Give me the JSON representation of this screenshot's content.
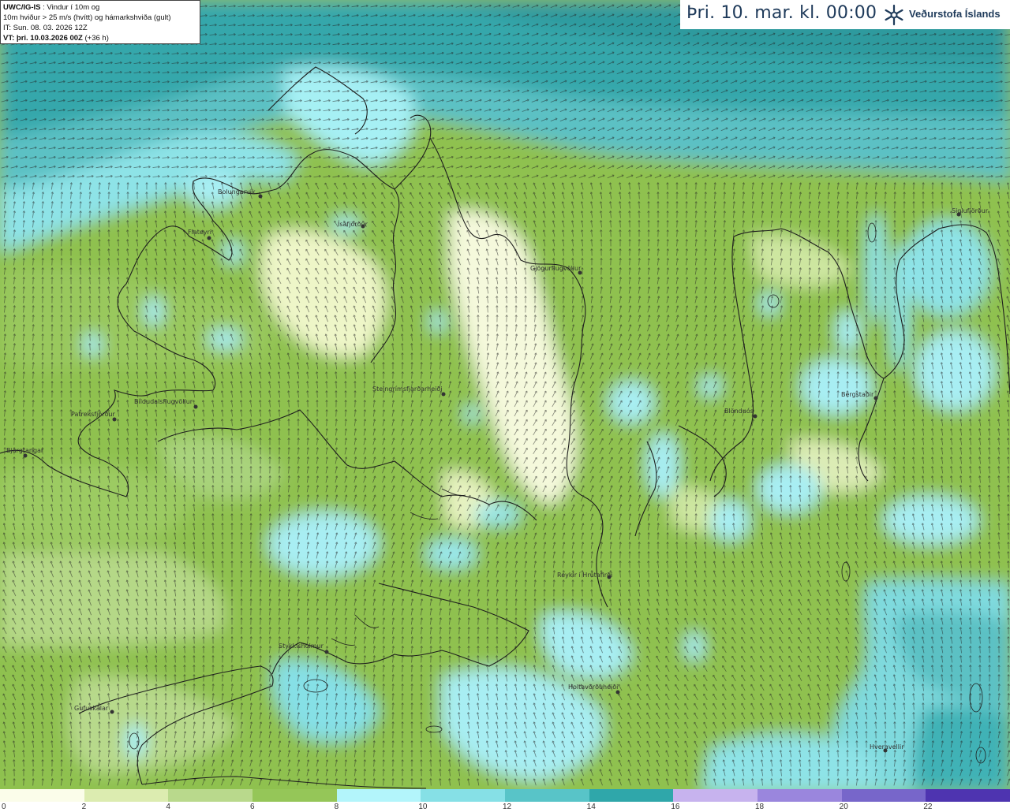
{
  "header": {
    "model": "UWC/IG-IS",
    "desc1": " : Vindur í 10m og",
    "desc2": "10m hviður > 25 m/s (hvítt) og hámarkshviða (gult)",
    "it_line": "IT: Sun. 08. 03. 2026 12Z",
    "vt_bold": "VT: þri. 10.03.2026 00Z",
    "vt_rest": " (+36 h)"
  },
  "date_title": "Þri. 10. mar. kl. 00:00",
  "logo": {
    "text": "Veðurstofa Íslands",
    "icon": "snowflake-logo-icon"
  },
  "colorbar": {
    "labels": [
      "0",
      "2",
      "4",
      "6",
      "8",
      "10",
      "12",
      "14",
      "16",
      "18",
      "20",
      "22"
    ],
    "colors": [
      "#fbfdea",
      "#dcecb0",
      "#b9d98c",
      "#95c658",
      "#b3f5fb",
      "#86e0e6",
      "#58c4c8",
      "#2fa7aa",
      "#c7b3ee",
      "#9a86dd",
      "#7766ca",
      "#4e34b0"
    ]
  },
  "places": [
    {
      "name": "Bolungarvík"
    },
    {
      "name": "Ísafjörður"
    },
    {
      "name": "Flateyri"
    },
    {
      "name": "Patreksfjörður"
    },
    {
      "name": "Bíldudalsflugvöllur"
    },
    {
      "name": "Bjargtangar"
    },
    {
      "name": "Steingrímsfjarðarheiði"
    },
    {
      "name": "Gjögurflugvöllur"
    },
    {
      "name": "Siglufjörður"
    },
    {
      "name": "Bergstaðir"
    },
    {
      "name": "Blönduós"
    },
    {
      "name": "Reykir í Hrútafirði"
    },
    {
      "name": "Stykkishólmur"
    },
    {
      "name": "Holtavörðuheiði"
    },
    {
      "name": "Gufuskálar"
    },
    {
      "name": "Hveravellir"
    }
  ]
}
